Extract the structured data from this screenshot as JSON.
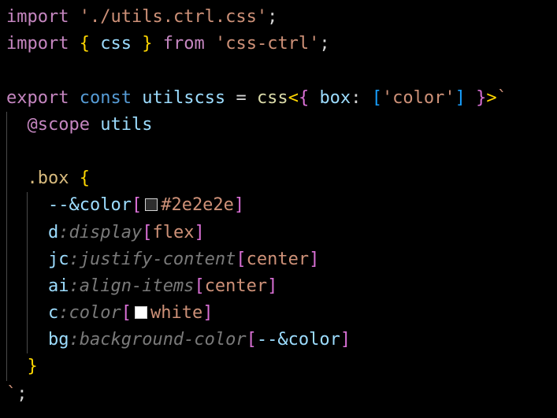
{
  "code": {
    "line1": {
      "import_kw": "import",
      "path": "'./utils.ctrl.css'",
      "semi": ";"
    },
    "line2": {
      "import_kw": "import",
      "lbrace": "{",
      "name": "css",
      "rbrace": "}",
      "from_kw": "from",
      "module": "'css-ctrl'",
      "semi": ";"
    },
    "line4": {
      "export_kw": "export",
      "const_kw": "const",
      "var_name": "utilscss",
      "eq": "=",
      "func": "css",
      "lt": "<",
      "lbrace": "{",
      "key": "box",
      "colon": ":",
      "lbracket": "[",
      "str": "'color'",
      "rbracket": "]",
      "rbrace": "}",
      "gt": ">",
      "tick": "`"
    },
    "line5": {
      "at": "@scope",
      "ident": "utils"
    },
    "line7": {
      "selector": ".box",
      "lbrace": "{"
    },
    "line8": {
      "prop": "--&color",
      "lb": "[",
      "value": "#2e2e2e",
      "rb": "]",
      "swatch_color": "#2e2e2e"
    },
    "line9": {
      "short": "d",
      "hint": ":display",
      "lb": "[",
      "value": "flex",
      "rb": "]"
    },
    "line10": {
      "short": "jc",
      "hint": ":justify-content",
      "lb": "[",
      "value": "center",
      "rb": "]"
    },
    "line11": {
      "short": "ai",
      "hint": ":align-items",
      "lb": "[",
      "value": "center",
      "rb": "]"
    },
    "line12": {
      "short": "c",
      "hint": ":color",
      "lb": "[",
      "value": "white",
      "rb": "]",
      "swatch_color": "#ffffff"
    },
    "line13": {
      "short": "bg",
      "hint": ":background-color",
      "lb": "[",
      "value": "--&color",
      "rb": "]"
    },
    "line14": {
      "rbrace": "}"
    },
    "line15": {
      "tick": "`",
      "semi": ";"
    }
  },
  "colors": {
    "background": "#000000",
    "keyword": "#c586c0",
    "storage": "#569cd6",
    "string": "#ce9178",
    "variable": "#9cdcfe",
    "function": "#dcdcaa",
    "selector": "#d7ba7d",
    "bracket_gold": "#ffd700",
    "bracket_pink": "#da70d6",
    "bracket_blue": "#179fff",
    "hint": "#7a7a7a"
  }
}
